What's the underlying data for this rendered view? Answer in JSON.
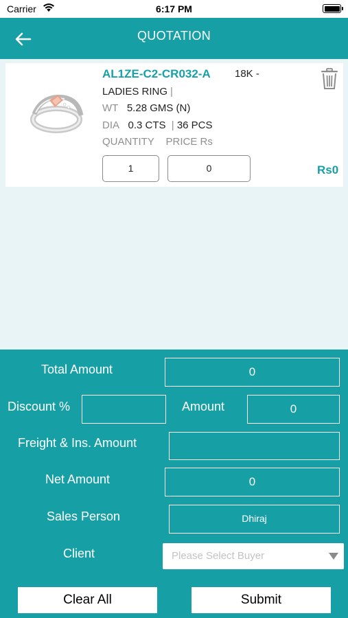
{
  "status_bar": {
    "carrier": "Carrier",
    "time": "6:17 PM"
  },
  "header": {
    "title": "QUOTATION"
  },
  "item": {
    "sku": "AL1ZE-C2-CR032-A",
    "purity": "18K -",
    "category": "LADIES RING",
    "category_sep": "|",
    "wt_label": "WT",
    "wt_value": "5.28 GMS (N)",
    "dia_label": "DIA",
    "dia_value": "0.3 CTS",
    "dia_sep": "|",
    "dia_pcs": "36 PCS",
    "quantity_label": "QUANTITY",
    "price_label": "PRICE Rs",
    "quantity_value": "1",
    "price_value": "0",
    "total": "Rs0"
  },
  "summary": {
    "total_amount_label": "Total Amount",
    "total_amount_value": "0",
    "discount_label": "Discount %",
    "discount_value": "",
    "amount_label": "Amount",
    "amount_value": "0",
    "freight_label": "Freight & Ins. Amount",
    "freight_value": "",
    "net_amount_label": "Net Amount",
    "net_amount_value": "0",
    "sales_person_label": "Sales Person",
    "sales_person_value": "Dhiraj",
    "client_label": "Client",
    "client_placeholder": "Please Select Buyer"
  },
  "actions": {
    "clear_label": "Clear All",
    "submit_label": "Submit"
  },
  "colors": {
    "primary": "#16a0a6",
    "background": "#e8f4f6",
    "card": "#ffffff"
  }
}
